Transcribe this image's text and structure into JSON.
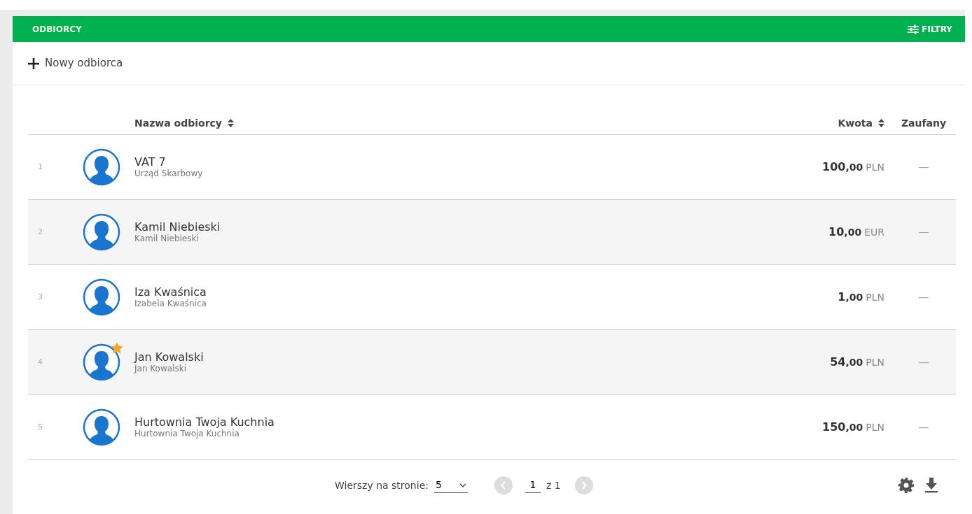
{
  "header": {
    "title": "ODBIORCY",
    "filter_button": "FILTRY"
  },
  "new_button": "Nowy odbiorca",
  "table": {
    "columns": [
      {
        "label": "Nazwa odbiorcy",
        "sortable": true
      },
      {
        "label": "Kwota",
        "sortable": true
      },
      {
        "label": "Zaufany",
        "sortable": false
      }
    ],
    "rows": [
      {
        "number": "1",
        "name": "VAT 7",
        "subtitle": "Urząd Skarbowy",
        "amount": "100",
        "decimals": ",00",
        "currency": "PLN",
        "trusted": "—",
        "favorite": false
      },
      {
        "number": "2",
        "name": "Kamil Niebieski",
        "subtitle": "Kamil Niebieski",
        "amount": "10",
        "decimals": ",00",
        "currency": "EUR",
        "trusted": "—",
        "favorite": false
      },
      {
        "number": "3",
        "name": "Iza Kwaśnica",
        "subtitle": "Izabela Kwaśnica",
        "amount": "1",
        "decimals": ",00",
        "currency": "PLN",
        "trusted": "—",
        "favorite": false
      },
      {
        "number": "4",
        "name": "Jan Kowalski",
        "subtitle": "Jan Kowalski",
        "amount": "54",
        "decimals": ",00",
        "currency": "PLN",
        "trusted": "—",
        "favorite": true
      },
      {
        "number": "5",
        "name": "Hurtownia Twoja Kuchnia",
        "subtitle": "Hurtownia Twoja Kuchnia",
        "amount": "150",
        "decimals": ",00",
        "currency": "PLN",
        "trusted": "—",
        "favorite": false
      }
    ]
  },
  "footer": {
    "rows_label": "Wierszy na stronie:",
    "rows_per_page": "5",
    "page": "1",
    "of_pages": "z 1",
    "prev_disabled": true,
    "next_disabled": true
  }
}
